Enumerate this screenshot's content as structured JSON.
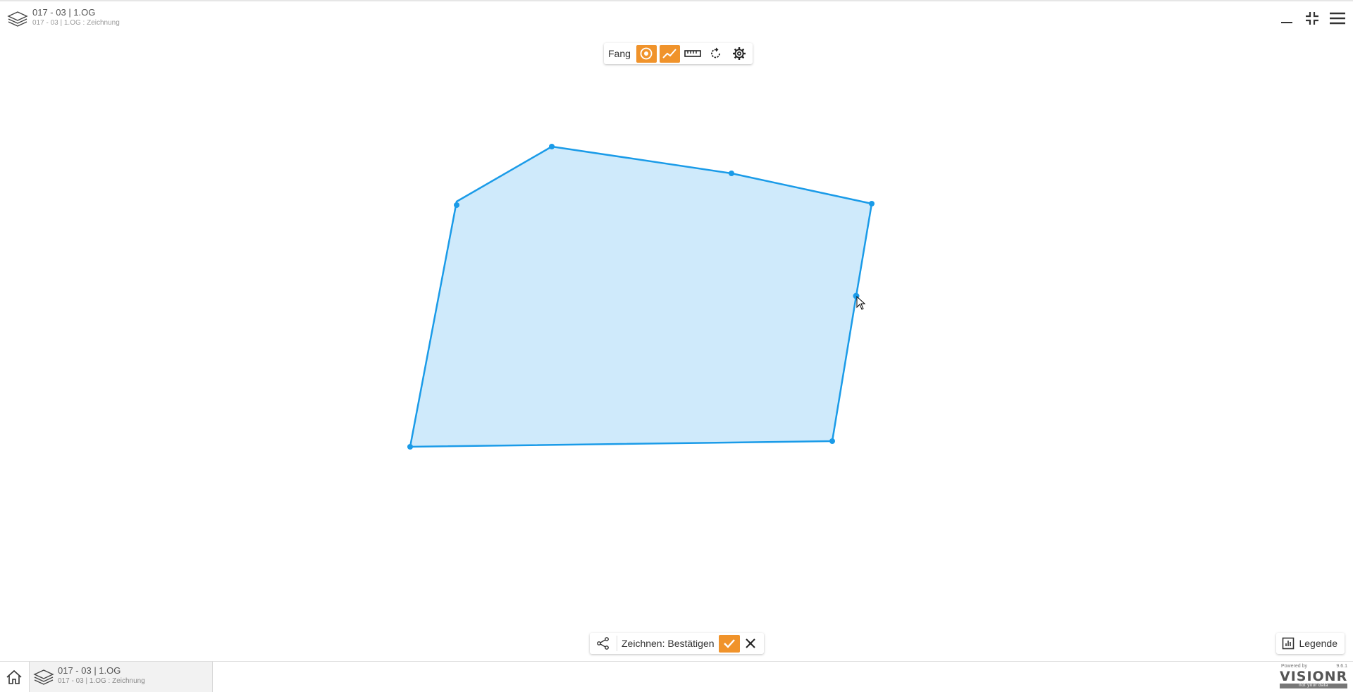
{
  "header": {
    "title": "017 - 03 | 1.OG",
    "subtitle": "017 - 03 | 1.OG : Zeichnung"
  },
  "toolbar": {
    "fang_label": "Fang",
    "tools": [
      {
        "name": "snap-point-icon",
        "active": true
      },
      {
        "name": "snap-line-icon",
        "active": true
      },
      {
        "name": "ruler-icon",
        "active": false
      },
      {
        "name": "rotate-icon",
        "active": false
      },
      {
        "name": "settings-icon",
        "active": false
      }
    ]
  },
  "confirm_bar": {
    "label": "Zeichnen: Bestätigen"
  },
  "legend": {
    "label": "Legende"
  },
  "bottom_tab": {
    "title": "017 - 03 | 1.OG",
    "subtitle": "017 - 03 | 1.OG : Zeichnung"
  },
  "brand": {
    "powered": "Powered by",
    "version": "9.6.1",
    "logo": "VISIONR",
    "tagline": "not your data"
  },
  "colors": {
    "accent": "#f0932b",
    "polygon_stroke": "#1a9be8",
    "polygon_fill": "#cfeafb"
  }
}
